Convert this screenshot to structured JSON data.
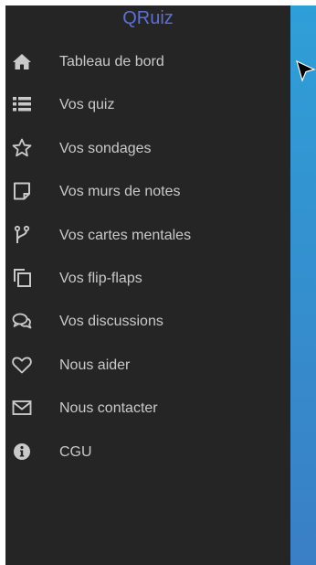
{
  "app": {
    "brand": "QRuiz"
  },
  "sidebar": {
    "items": [
      {
        "label": "Tableau de bord",
        "icon": "home-icon"
      },
      {
        "label": "Vos quiz",
        "icon": "list-icon"
      },
      {
        "label": "Vos sondages",
        "icon": "star-icon"
      },
      {
        "label": "Vos murs de notes",
        "icon": "sticky-note-icon"
      },
      {
        "label": "Vos cartes mentales",
        "icon": "branch-icon"
      },
      {
        "label": "Vos flip-flaps",
        "icon": "copy-icon"
      },
      {
        "label": "Vos discussions",
        "icon": "chat-bubbles-icon"
      },
      {
        "label": "Nous aider",
        "icon": "heart-icon"
      },
      {
        "label": "Nous contacter",
        "icon": "envelope-icon"
      },
      {
        "label": "CGU",
        "icon": "info-icon"
      }
    ]
  },
  "colors": {
    "sidebar_bg": "#252525",
    "brand": "#5b6fd6",
    "label": "#c9c9c9",
    "content": "#2f9fd8"
  }
}
